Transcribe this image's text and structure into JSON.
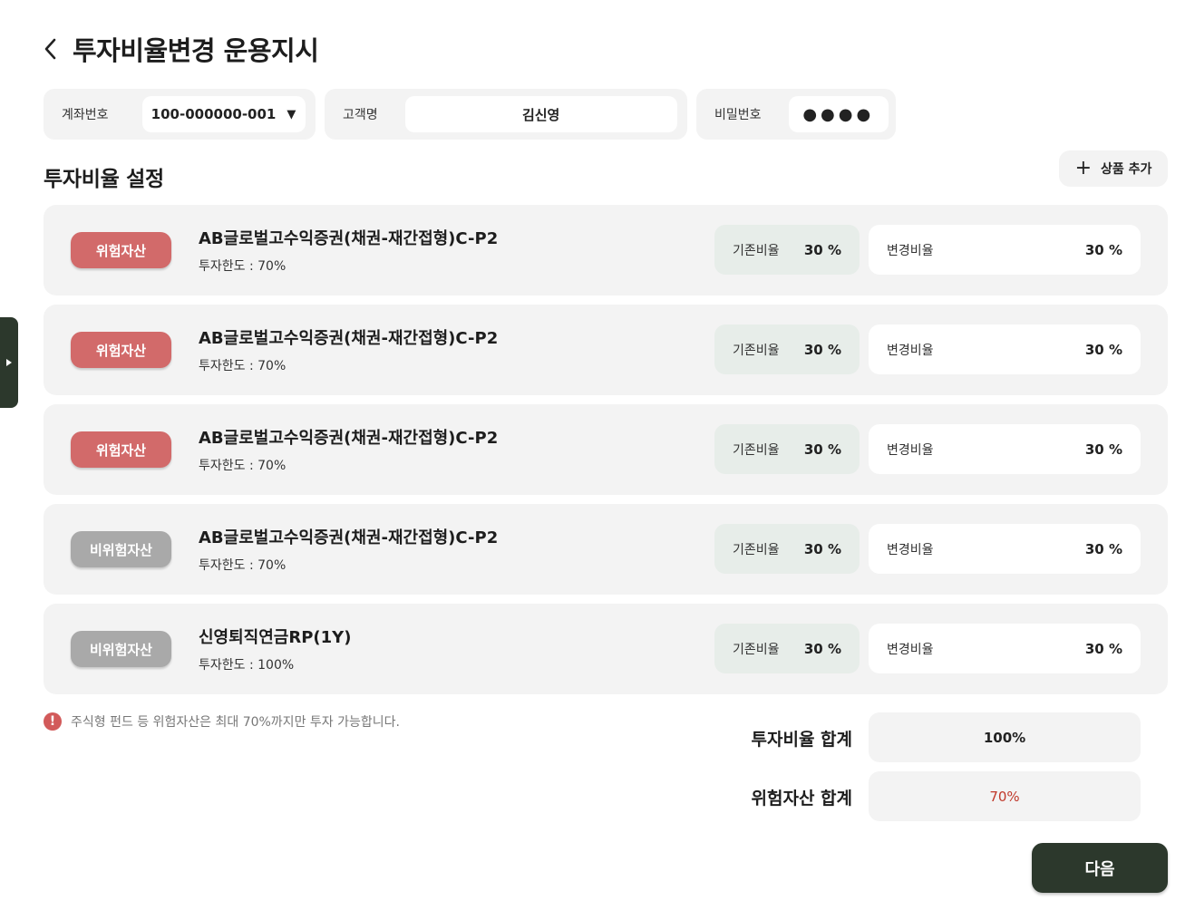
{
  "header": {
    "title": "투자비율변경 운용지시"
  },
  "account": {
    "label": "계좌번호",
    "value": "100-000000-001",
    "caret": "▼"
  },
  "customer": {
    "label": "고객명",
    "value": "김신영"
  },
  "password": {
    "label": "비밀번호",
    "value": "●●●●"
  },
  "section": {
    "title": "투자비율 설정",
    "add_label": "상품 추가",
    "add_icon": "plus-icon"
  },
  "products": [
    {
      "badge": "위험자산",
      "type": "risk",
      "name": "AB글로벌고수익증권(채권-재간접형)C-P2",
      "limit": "투자한도 : 70%",
      "exist_label": "기존비율",
      "exist_value": "30 %",
      "change_label": "변경비율",
      "change_value": "30 %"
    },
    {
      "badge": "위험자산",
      "type": "risk",
      "name": "AB글로벌고수익증권(채권-재간접형)C-P2",
      "limit": "투자한도 : 70%",
      "exist_label": "기존비율",
      "exist_value": "30 %",
      "change_label": "변경비율",
      "change_value": "30 %"
    },
    {
      "badge": "위험자산",
      "type": "risk",
      "name": "AB글로벌고수익증권(채권-재간접형)C-P2",
      "limit": "투자한도 : 70%",
      "exist_label": "기존비율",
      "exist_value": "30 %",
      "change_label": "변경비율",
      "change_value": "30 %"
    },
    {
      "badge": "비위험자산",
      "type": "norisk",
      "name": "AB글로벌고수익증권(채권-재간접형)C-P2",
      "limit": "투자한도 : 70%",
      "exist_label": "기존비율",
      "exist_value": "30 %",
      "change_label": "변경비율",
      "change_value": "30 %"
    },
    {
      "badge": "비위험자산",
      "type": "norisk",
      "name": "신영퇴직연금RP(1Y)",
      "limit": "투자한도 : 100%",
      "exist_label": "기존비율",
      "exist_value": "30 %",
      "change_label": "변경비율",
      "change_value": "30 %"
    }
  ],
  "notice": {
    "icon": "!",
    "text": "주식형 펀드 등 위험자산은 최대 70%까지만 투자 가능합니다."
  },
  "summary": {
    "total_label": "투자비율 합계",
    "total_value": "100%",
    "risk_label": "위험자산 합계",
    "risk_value": "70%"
  },
  "next_label": "다음",
  "colors": {
    "risk": "#d26a6a",
    "norisk": "#a9a9a9",
    "primary": "#2c382c",
    "risk_total": "#c0392b"
  }
}
